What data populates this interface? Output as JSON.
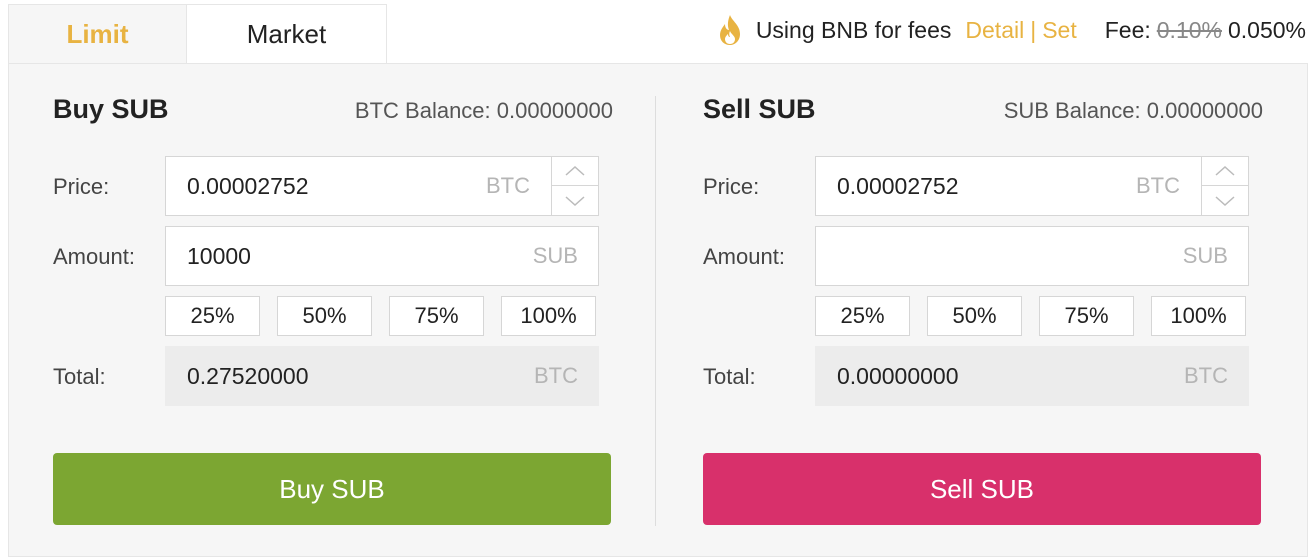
{
  "tabs": {
    "limit": "Limit",
    "market": "Market",
    "active": "limit"
  },
  "fees": {
    "bnb_text": "Using BNB for fees",
    "detail": "Detail",
    "separator": "|",
    "set": "Set",
    "fee_label": "Fee:",
    "fee_old": "0.10%",
    "fee_new": "0.050%"
  },
  "colors": {
    "accent": "#e8b342",
    "buy": "#7ca632",
    "sell": "#d8306b"
  },
  "labels": {
    "price": "Price:",
    "amount": "Amount:",
    "total": "Total:"
  },
  "percent_options": [
    "25%",
    "50%",
    "75%",
    "100%"
  ],
  "buy": {
    "title": "Buy SUB",
    "balance": "BTC Balance: 0.00000000",
    "price": "0.00002752",
    "price_unit": "BTC",
    "amount": "10000",
    "amount_unit": "SUB",
    "total": "0.27520000",
    "total_unit": "BTC",
    "button": "Buy SUB"
  },
  "sell": {
    "title": "Sell SUB",
    "balance": "SUB Balance: 0.00000000",
    "price": "0.00002752",
    "price_unit": "BTC",
    "amount": "",
    "amount_unit": "SUB",
    "total": "0.00000000",
    "total_unit": "BTC",
    "button": "Sell SUB"
  }
}
